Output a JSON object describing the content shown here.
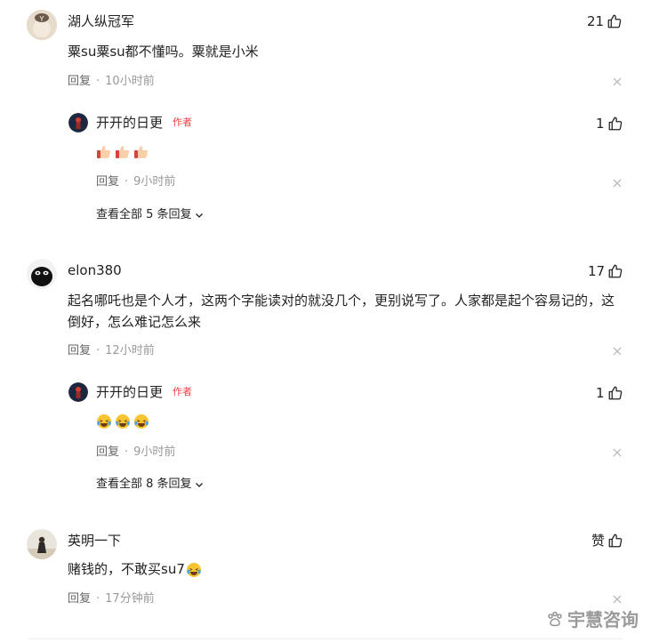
{
  "comments": [
    {
      "username": "湖人纵冠军",
      "likes": "21",
      "text": "粟su粟su都不懂吗。粟就是小米",
      "reply_label": "回复",
      "time": "10小时前",
      "reply": {
        "username": "开开的日更",
        "badge": "作者",
        "likes": "1",
        "reply_label": "回复",
        "time": "9小时前"
      },
      "view_all": "查看全部 5 条回复"
    },
    {
      "username": "elon380",
      "likes": "17",
      "text": "起名哪吒也是个人才，这两个字能读对的就没几个，更别说写了。人家都是起个容易记的，这倒好，怎么难记怎么来",
      "reply_label": "回复",
      "time": "12小时前",
      "reply": {
        "username": "开开的日更",
        "badge": "作者",
        "likes": "1",
        "reply_label": "回复",
        "time": "9小时前"
      },
      "view_all": "查看全部 8 条回复"
    },
    {
      "username": "英明一下",
      "likes": "赞",
      "text": "赌钱的，不敢买su7",
      "reply_label": "回复",
      "time": "17分钟前"
    }
  ],
  "watermark": "宇慧咨询",
  "colors": {
    "author_badge": "#f04142",
    "meta_time": "#999999"
  }
}
